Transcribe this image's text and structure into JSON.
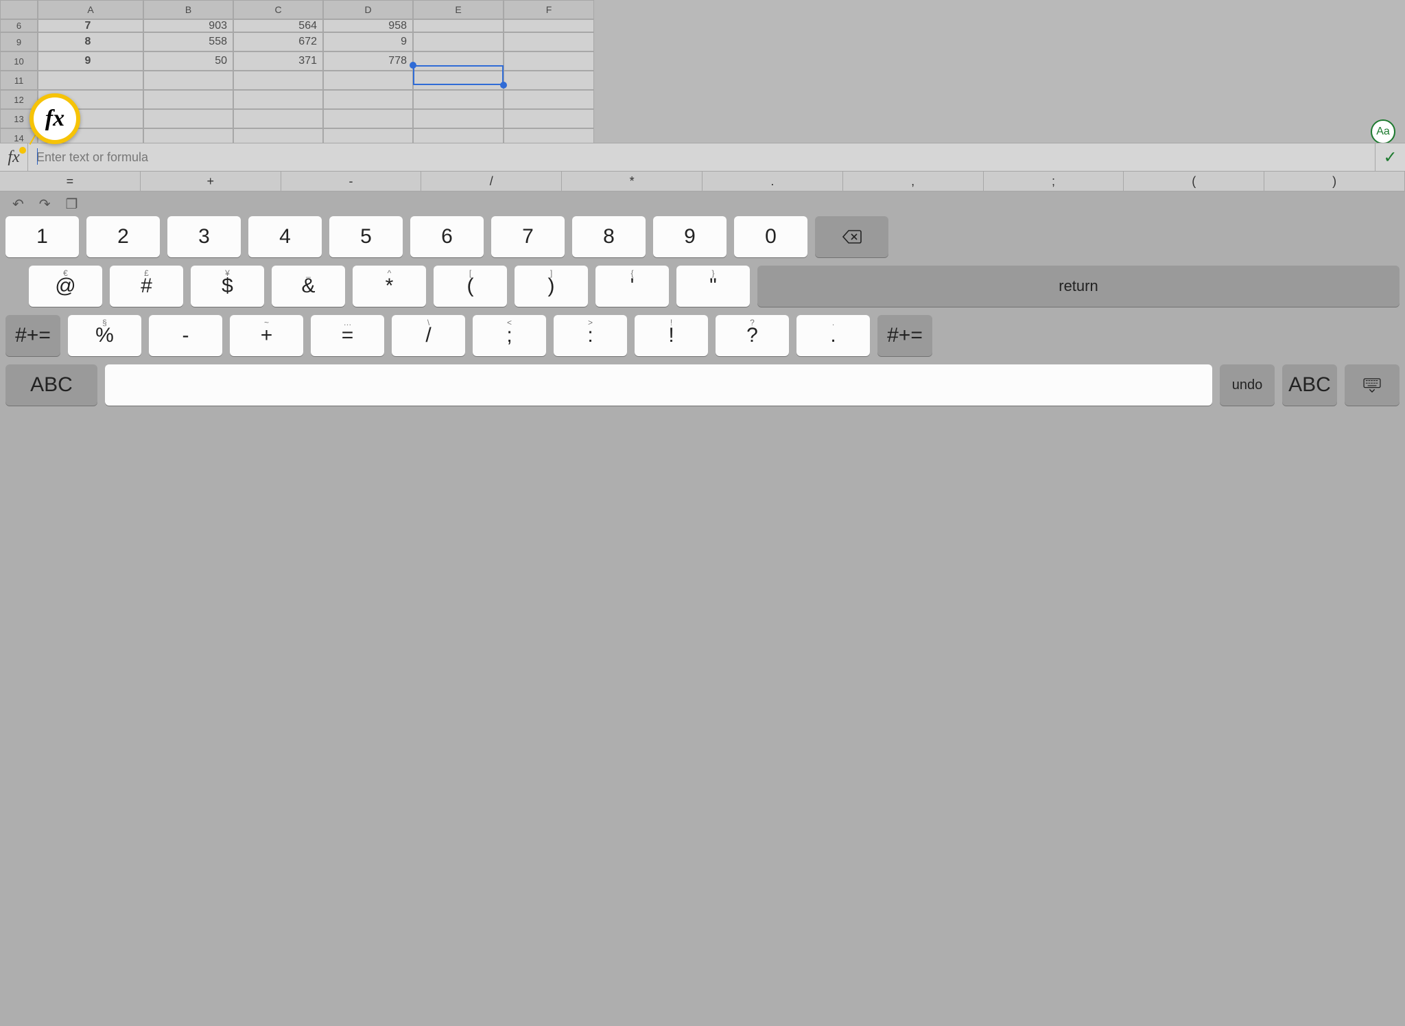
{
  "columns": [
    "A",
    "B",
    "C",
    "D",
    "E",
    "F"
  ],
  "rows": [
    {
      "n": "6",
      "A": "7",
      "B": "903",
      "C": "564",
      "D": "958",
      "E": "",
      "F": ""
    },
    {
      "n": "9",
      "A": "8",
      "B": "558",
      "C": "672",
      "D": "9",
      "E": "",
      "F": ""
    },
    {
      "n": "10",
      "A": "9",
      "B": "50",
      "C": "371",
      "D": "778",
      "E": "",
      "F": ""
    },
    {
      "n": "11",
      "A": "",
      "B": "",
      "C": "",
      "D": "",
      "E": "",
      "F": ""
    },
    {
      "n": "12",
      "A": "",
      "B": "",
      "C": "",
      "D": "",
      "E": "",
      "F": ""
    },
    {
      "n": "13",
      "A": "",
      "B": "",
      "C": "",
      "D": "",
      "E": "",
      "F": ""
    },
    {
      "n": "14",
      "A": "",
      "B": "",
      "C": "",
      "D": "",
      "E": "",
      "F": ""
    }
  ],
  "selected_cell": "E11",
  "fx": {
    "label": "fx",
    "placeholder": "Enter text or formula",
    "check": "✓"
  },
  "aa_badge": "Aa",
  "highlight": {
    "magnifier": "fx"
  },
  "symbols": [
    "=",
    "+",
    "-",
    "/",
    "*",
    ".",
    ",",
    ";",
    "(",
    ")"
  ],
  "kb": {
    "tools": {
      "undo": "↶",
      "redo": "↷",
      "clipboard": "❐"
    },
    "row1": [
      "1",
      "2",
      "3",
      "4",
      "5",
      "6",
      "7",
      "8",
      "9",
      "0"
    ],
    "backspace": "⌫",
    "row2": [
      {
        "m": "@",
        "s": "€"
      },
      {
        "m": "#",
        "s": "£"
      },
      {
        "m": "$",
        "s": "¥"
      },
      {
        "m": "&",
        "s": "_"
      },
      {
        "m": "*",
        "s": "^"
      },
      {
        "m": "(",
        "s": "["
      },
      {
        "m": ")",
        "s": "]"
      },
      {
        "m": "'",
        "s": "{"
      },
      {
        "m": "\"",
        "s": "}"
      }
    ],
    "return": "return",
    "row3_shift_left": "#+=",
    "row3": [
      {
        "m": "%",
        "s": "§"
      },
      {
        "m": "-",
        "s": ""
      },
      {
        "m": "+",
        "s": "~"
      },
      {
        "m": "=",
        "s": "…"
      },
      {
        "m": "/",
        "s": "\\"
      },
      {
        "m": ";",
        "s": "<"
      },
      {
        "m": ":",
        "s": ">"
      },
      {
        "m": "!",
        "s": "!"
      },
      {
        "m": "?",
        "s": "?"
      },
      {
        "m": ".",
        "s": "."
      }
    ],
    "row3_shift_right": "#+=",
    "row4": {
      "abc_left": "ABC",
      "undo": "undo",
      "abc_right": "ABC"
    }
  }
}
